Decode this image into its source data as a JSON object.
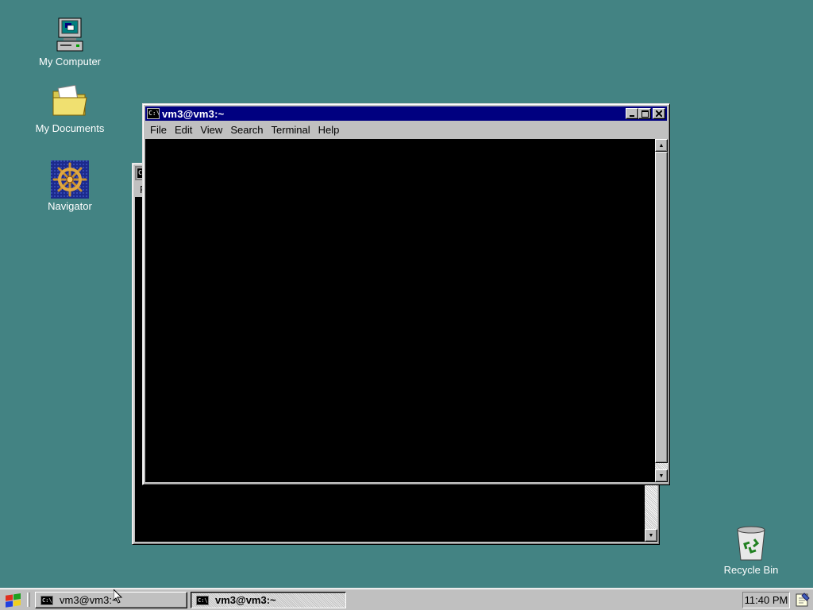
{
  "desktop": {
    "icons": [
      {
        "label": "My Computer",
        "icon": "computer-icon"
      },
      {
        "label": "My Documents",
        "icon": "folder-icon"
      },
      {
        "label": "Navigator",
        "icon": "ship-wheel-icon"
      },
      {
        "label": "Recycle Bin",
        "icon": "recycle-bin-icon"
      }
    ],
    "background_color": "#438383"
  },
  "window_active": {
    "title": "vm3@vm3:~",
    "menu": [
      "File",
      "Edit",
      "View",
      "Search",
      "Terminal",
      "Help"
    ],
    "title_icon_text": "C:\\",
    "buttons": [
      "minimize",
      "maximize",
      "close"
    ]
  },
  "window_background": {
    "title_icon_text": "C:\\",
    "menu_partial": "F"
  },
  "taskbar": {
    "start_icon": "start-logo-icon",
    "tasks": [
      {
        "label": "vm3@vm3:~",
        "active": false
      },
      {
        "label": "vm3@vm3:~",
        "active": true
      }
    ],
    "clock": "11:40 PM",
    "tray_icon": "notepad-icon"
  },
  "colors": {
    "title_active": "#000080",
    "title_inactive": "#808080",
    "window_face": "#c0c0c0",
    "terminal_bg": "#000000"
  }
}
